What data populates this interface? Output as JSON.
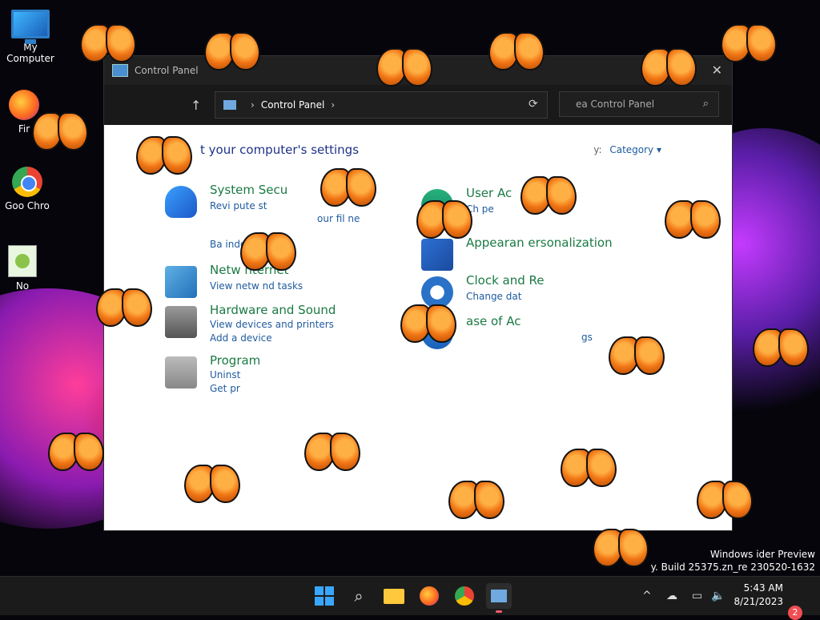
{
  "desktop": {
    "icons": [
      {
        "label": "My Computer"
      },
      {
        "label": "Fir"
      },
      {
        "label": "Goo Chro"
      },
      {
        "label": "No"
      }
    ],
    "watermark": {
      "line1": "Windows ider Preview",
      "line2": "y. Build 25375.zn_re 230520-1632"
    }
  },
  "window": {
    "title": "Control Panel",
    "close_glyph": "✕",
    "up_glyph": "↑",
    "address": {
      "crumb": "Control Panel",
      "sep": "›",
      "end_sep": "›"
    },
    "refresh_glyph": "⟳",
    "search": {
      "placeholder": "ea Control Panel",
      "icon": "⌕"
    },
    "heading": "t your computer's settings",
    "view_by": {
      "label": "y:",
      "value": "Category ▾"
    },
    "categories_left": [
      {
        "title": "System Secu",
        "links": [
          "Revi pute st",
          "our fil ne",
          "Ba indows 7)"
        ]
      },
      {
        "title": "Netw nternet",
        "links": [
          "View netw nd tasks"
        ]
      },
      {
        "title": "Hardware and Sound",
        "links": [
          "View devices and printers",
          "Add a device"
        ]
      },
      {
        "title": "Program",
        "links": [
          "Uninst",
          "Get pr"
        ]
      }
    ],
    "categories_right": [
      {
        "title": "User Ac",
        "links": [
          "Ch pe"
        ]
      },
      {
        "title": "Appearan ersonalization",
        "links": []
      },
      {
        "title": "Clock and Re",
        "links": [
          "Change dat"
        ]
      },
      {
        "title": "ase of Ac",
        "links": [
          "gs"
        ]
      }
    ]
  },
  "taskbar": {
    "search_glyph": "⌕",
    "tray": {
      "chevron": "^",
      "time": "5:43 AM",
      "date": "8/21/2023",
      "notifications": "2"
    }
  },
  "colors": {
    "accent": "#39a7ff",
    "link": "#1e5a9e",
    "category": "#1b7a44",
    "butterfly": "#f07414"
  }
}
